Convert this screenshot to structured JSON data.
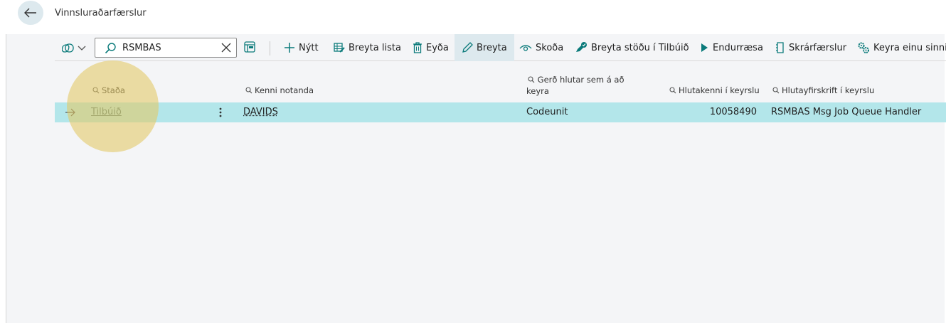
{
  "page": {
    "title": "Vinnsluraðarfærslur"
  },
  "search": {
    "value": "RSMBAS"
  },
  "toolbar": {
    "new_label": "Nýtt",
    "edit_list_label": "Breyta lista",
    "delete_label": "Eyða",
    "edit_label": "Breyta",
    "view_label": "Skoða",
    "set_ready_label": "Breyta stöðu í Tilbúið",
    "restart_label": "Endurræsa",
    "log_entries_label": "Skrárfærslur",
    "run_once_label": "Keyra einu sinni ("
  },
  "columns": {
    "status": "Staða",
    "user_id": "Kenni notanda",
    "object_type": "Gerð hlutar sem á að keyra",
    "object_id": "Hlutakenni í keyrslu",
    "object_caption": "Hlutayfirskrift í keyrslu"
  },
  "rows": [
    {
      "status": "Tilbúið",
      "user_id": "DAVIDS",
      "object_type": "Codeunit",
      "object_id": "10058490",
      "object_caption": "RSMBAS Msg Job Queue Handler"
    }
  ],
  "colors": {
    "selected_row": "#b3e6ea",
    "accent": "#0a7a7a",
    "highlight": "#e3c864"
  }
}
